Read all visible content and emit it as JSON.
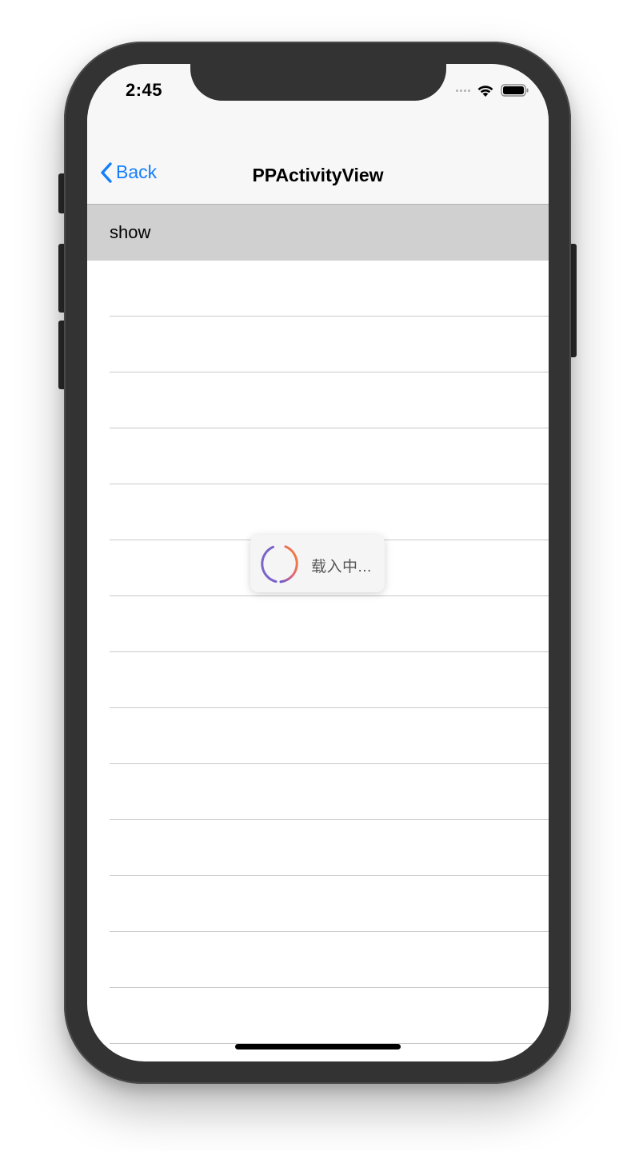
{
  "status_bar": {
    "time": "2:45"
  },
  "nav": {
    "back_label": "Back",
    "title": "PPActivityView"
  },
  "table": {
    "rows": [
      {
        "label": "show",
        "selected": true
      },
      {
        "label": ""
      },
      {
        "label": ""
      },
      {
        "label": ""
      },
      {
        "label": ""
      },
      {
        "label": ""
      },
      {
        "label": ""
      },
      {
        "label": ""
      },
      {
        "label": ""
      },
      {
        "label": ""
      },
      {
        "label": ""
      },
      {
        "label": ""
      },
      {
        "label": ""
      },
      {
        "label": ""
      },
      {
        "label": ""
      },
      {
        "label": ""
      },
      {
        "label": ""
      }
    ]
  },
  "hud": {
    "text": "载入中..."
  },
  "colors": {
    "tint": "#147efb",
    "frame": "#333333",
    "selected_row": "#d0d0d0",
    "spinner_start": "#f5822a",
    "spinner_end": "#6a5acd"
  },
  "icons": {
    "back": "chevron-left-icon",
    "wifi": "wifi-icon",
    "battery": "battery-icon",
    "signal": "signal-icon",
    "spinner": "loading-spinner-icon"
  }
}
